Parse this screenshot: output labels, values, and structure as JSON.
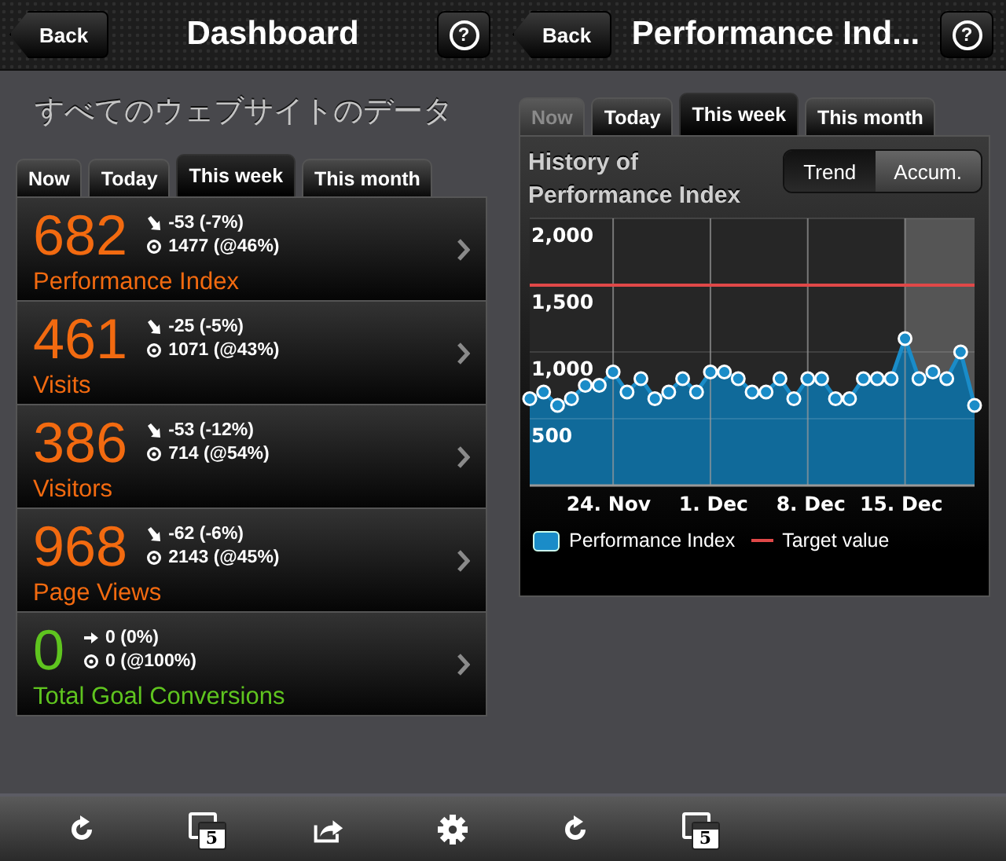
{
  "left": {
    "header": {
      "back": "Back",
      "title": "Dashboard",
      "help": "?"
    },
    "heading": "すべてのウェブサイトのデータ",
    "tabs": [
      {
        "label": "Now",
        "selected": false
      },
      {
        "label": "Today",
        "selected": false
      },
      {
        "label": "This week",
        "selected": true
      },
      {
        "label": "This month",
        "selected": false
      }
    ],
    "metrics": [
      {
        "value": "682",
        "label": "Performance Index",
        "color": "#f26a10",
        "kind": "down",
        "change": "-53 (-7%)",
        "goal": "1477 (@46%)"
      },
      {
        "value": "461",
        "label": "Visits",
        "color": "#f26a10",
        "kind": "down",
        "change": "-25 (-5%)",
        "goal": "1071 (@43%)"
      },
      {
        "value": "386",
        "label": "Visitors",
        "color": "#f26a10",
        "kind": "down",
        "change": "-53 (-12%)",
        "goal": "714 (@54%)"
      },
      {
        "value": "968",
        "label": "Page Views",
        "color": "#f26a10",
        "kind": "down",
        "change": "-62 (-6%)",
        "goal": "2143 (@45%)"
      },
      {
        "value": "0",
        "label": "Total Goal Conversions",
        "color": "#5fc41f",
        "kind": "flat",
        "change": "0 (0%)",
        "goal": "0 (@100%)"
      }
    ]
  },
  "right": {
    "header": {
      "back": "Back",
      "title": "Performance Ind...",
      "help": "?"
    },
    "tabs": [
      {
        "label": "Now",
        "selected": false,
        "disabled": true
      },
      {
        "label": "Today",
        "selected": false,
        "disabled": false
      },
      {
        "label": "This week",
        "selected": true,
        "disabled": false
      },
      {
        "label": "This month",
        "selected": false,
        "disabled": false
      }
    ],
    "title": "History of Performance Index",
    "modes": [
      {
        "label": "Trend",
        "selected": true
      },
      {
        "label": "Accum.",
        "selected": false
      }
    ],
    "chart_data": {
      "type": "area",
      "categories": [
        null,
        null,
        null,
        null,
        null,
        null,
        "24. Nov",
        null,
        null,
        null,
        null,
        null,
        null,
        "1. Dec",
        null,
        null,
        null,
        null,
        null,
        null,
        "8. Dec",
        null,
        null,
        null,
        null,
        null,
        null,
        "15. Dec",
        null,
        null,
        null,
        null,
        null
      ],
      "series": [
        {
          "name": "Performance Index",
          "type": "area",
          "color": "#1a8cc8",
          "values": [
            650,
            700,
            600,
            650,
            750,
            750,
            850,
            700,
            800,
            650,
            700,
            800,
            700,
            850,
            850,
            800,
            700,
            700,
            800,
            650,
            800,
            800,
            650,
            650,
            800,
            800,
            800,
            1100,
            800,
            850,
            800,
            1000,
            600
          ]
        },
        {
          "name": "Target value",
          "type": "line",
          "color": "#e04848",
          "values": [
            1500,
            1500,
            1500,
            1500,
            1500,
            1500,
            1500,
            1500,
            1500,
            1500,
            1500,
            1500,
            1500,
            1500,
            1500,
            1500,
            1500,
            1500,
            1500,
            1500,
            1500,
            1500,
            1500,
            1500,
            1500,
            1500,
            1500,
            1500,
            1500,
            1500,
            1500,
            1500,
            1500
          ]
        }
      ],
      "ylim": [
        0,
        2000
      ],
      "grid": true,
      "yticks": [
        {
          "value": 500,
          "label": "500"
        },
        {
          "value": 1000,
          "label": "1,000"
        },
        {
          "value": 1500,
          "label": "1,500"
        },
        {
          "value": 2000,
          "label": "2,000"
        }
      ]
    }
  },
  "toolbar": [
    {
      "kind": "refresh"
    },
    {
      "kind": "calendar",
      "badge": "5"
    },
    {
      "kind": "share"
    },
    {
      "kind": "settings"
    },
    {
      "kind": "refresh"
    },
    {
      "kind": "calendar",
      "badge": "5"
    }
  ]
}
